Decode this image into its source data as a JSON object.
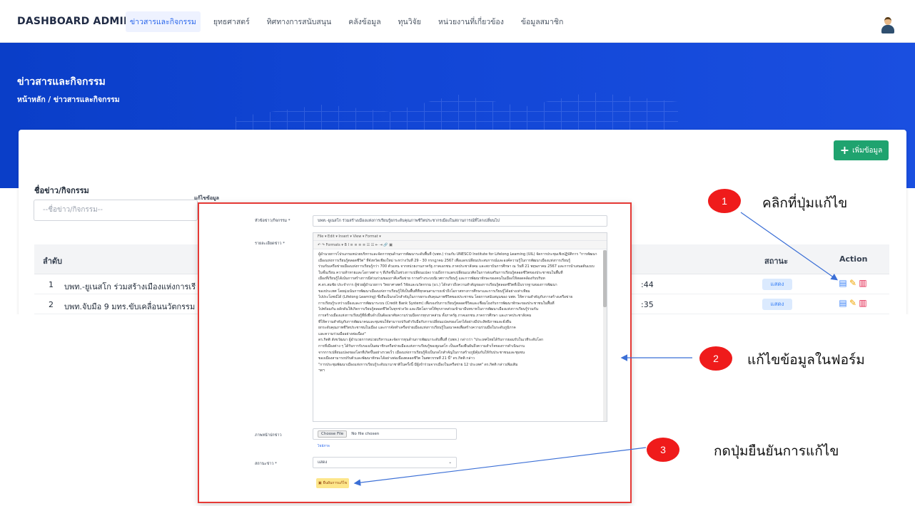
{
  "nav": {
    "brand": "DASHBOARD ADMIN",
    "menu": [
      "ข่าวสารและกิจกรรม",
      "ยุทธศาสตร์",
      "ทิศทางการสนับสนุน",
      "คลังข้อมูล",
      "ทุนวิจัย",
      "หน่วยงานที่เกี่ยวข้อง",
      "ข้อมูลสมาชิก"
    ]
  },
  "hero": {
    "title": "ข่าวสารและกิจกรรม",
    "breadcrumb": "หน้าหลัก / ข่าวสารและกิจกรรม"
  },
  "toolbar": {
    "add_label": "เพิ่มข้อมูล"
  },
  "filter": {
    "label": "ชื่อข่าว/กิจกรรม",
    "placeholder": "--ชื่อข่าว/กิจกรรม--"
  },
  "table": {
    "columns": [
      "ลำดับ",
      "สถานะ",
      "Action"
    ],
    "rows": [
      {
        "no": "1",
        "title": "บพท.-ยูเนสโก ร่วมสร้างเมืองแห่งการเรี",
        "time": ":44",
        "status": "แสดง"
      },
      {
        "no": "2",
        "title": "บพท.จับมือ 9 มทร.ขับเคลื่อนนวัตกรรม",
        "time": ":35",
        "status": "แสดง"
      }
    ]
  },
  "modal": {
    "title": "แก้ไขข้อมูล",
    "headline_label": "หัวข้อข่าว/กิจกรรม *",
    "headline_value": "บพท.-ยูเนสโก ร่วมสร้างเมืองแห่งการเรียนรู้ยกระดับคุณภาพชีวิตประชากรเมืองในสถานการณ์ที่โลกเปลี่ยนไป",
    "detail_label": "รายละเอียดข่าว *",
    "editor_menu": "File ▾   Edit ▾   Insert ▾   View ▾   Format ▾",
    "editor_tools": "↶  ↷   Formats ▾   B   I   ≡  ≡  ≡  ≡   ☷  ☷  ⇤  ⇥   🔗  ▣",
    "editor_lines": [
      "ผู้อำนวยการโปรแกรมหน่วยบริหารและจัดการทุนด้านการพัฒนาระดับพื้นที่ (บพท.) ร่วมกับ UNESCO Institute for Lifelong Learning (UIL) จัดการประชุมเชิงปฏิบัติการ \"การพัฒนา",
      "เมืองแห่งการเรียนรู้ตลอดชีวิต\" ที่จังหวัดเชียงใหม่ ระหว่างวันที่ 29 - 30 กรกฎาคม 2567 เพื่อแลกเปลี่ยนประสบการณ์และองค์ความรู้ในการพัฒนาเมืองแห่งการเรียนรู้",
      "ร่วมกับเครือข่ายเมืองแห่งการเรียนรู้กว่า 700 ตัวแทน จากหน่วยงานภาครัฐ ภาคเอกชน ภาคประชาสังคม และสถาบันการศึกษา ณ วันที่ 21 พฤษภาคม 2567 และการนำเสนอต้นแบบ",
      "ในชั้นเรียน ความท้าทายและโอกาสต่าง ๆ ที่เกิดขึ้นในช่วงการเปลี่ยนแปลง รวมถึงการแลกเปลี่ยนแนวคิดในการส่งเสริมการเรียนรู้ตลอดชีวิตของประชาชนในพื้นที่",
      "เมืองที่เรียนรู้ได้เน้นการสร้างการมีส่วนร่วมของภาคีเครือข่าย การสร้างระบบนิเวศการเรียนรู้ และการพัฒนาทักษะของคนในเมืองให้สอดคล้องกับบริบท",
      "ศ.ดร.สมชัย ประจำการ ผู้ช่วยผู้อำนวยการ วิทยาศาสตร์ วิจัยและนวัตกรรม (อว.) ได้กล่าวถึงความสำคัญของการเรียนรู้ตลอดชีวิตที่เป็นรากฐานของการพัฒนา",
      "ของประเทศ โดยมุ่งเน้นการพัฒนาเมืองแห่งการเรียนรู้ให้เป็นพื้นที่ที่ทุกคนสามารถเข้าถึงโอกาสทางการศึกษาและการเรียนรู้ได้อย่างเท่าเทียม",
      "ไปประโยชน์ได้ (Lifelong Learning) ซึ่งถือเป็นกลไกสำคัญในการยกระดับคุณภาพชีวิตของประชาชน โดยการสนับสนุนของ บพท. ให้ความสำคัญกับการสร้างเครือข่าย",
      "การเรียนรู้ระหว่างเมืองและการพัฒนาระบบ (Credit Bank System) เพื่อรองรับการเรียนรู้ตลอดชีวิตและเชื่อมโยงกับการพัฒนาทักษะของประชาชนในพื้นที่",
      "ไปพร้อมกัน ผลักดันให้เกิดการเรียนรู้ตลอดชีวิตในทุกช่วงวัย และเปิดโอกาสให้ทุกภาคส่วนเข้ามามีบทบาทในการพัฒนาเมืองแห่งการเรียนรู้ร่วมกัน",
      "การสร้างเมืองแห่งการเรียนรู้ที่ยั่งยืนจำเป็นต้องอาศัยความร่วมมือจากทุกภาคส่วน ทั้งภาครัฐ ภาคเอกชน ภาคการศึกษา และภาคประชาสังคม",
      "ที่ให้ความสำคัญกับการพัฒนาคนและชุมชนให้สามารถปรับตัวรับมือกับการเปลี่ยนแปลงของโลกได้อย่างมีประสิทธิภาพและยั่งยืน",
      "ยกระดับคุณภาพชีวิตประชาชนในเมือง และการจัดทำเครือข่ายเมืองแห่งการเรียนรู้ในอนาคตเพื่อสร้างความร่วมมือในระดับภูมิภาค",
      "และความร่วมมืออย่างต่อเนื่อง\"",
      "ดร.กิตติ สังขวัฒนา ผู้อำนวยการหน่วยบริหารและจัดการทุนด้านการพัฒนาระดับพื้นที่ (บพท.) กล่าวว่า \"ประเทศไทยได้รับการยอมรับในเวทีระดับโลก",
      "การที่เมืองต่าง ๆ ได้รับการรับรองเป็นสมาชิกเครือข่ายเมืองแห่งการเรียนรู้ของยูเนสโก เป็นเครื่องยืนยันถึงความสำเร็จของการดำเนินงาน",
      "จากการเปลี่ยนแปลงของโลกที่เกิดขึ้นอย่างรวดเร็ว เมืองแห่งการเรียนรู้จึงเป็นกลไกสำคัญในการสร้างภูมิคุ้มกันให้กับประชาชนและชุมชน",
      "ของเมืองสามารถปรับตัวและพัฒนาทักษะได้อย่างต่อเนื่องตลอดชีวิต ในศตวรรษที่ 21 นี้\" ดร.กิตติ กล่าว",
      "\"การประชุมพัฒนาเมืองแห่งการเรียนรู้ระดับนานาชาติในครั้งนี้ มีผู้เข้าร่วมจากเมืองในเครือข่าย 12 ประเทศ\" ดร.กิตติ กล่าวเพิ่มเติม",
      "ฯลฯ"
    ],
    "image_label": "ภาพหน้าปกข่าว",
    "file_button": "Choose File",
    "file_status": "No file chosen",
    "file_hint": "ไฟล์ภาพ",
    "status_label": "สถานะข่าว *",
    "status_value": "แสดง",
    "submit_label": "ยืนยันการแก้ไข"
  },
  "callouts": [
    {
      "number": "1",
      "text": "คลิกที่ปุ่มแก้ไข"
    },
    {
      "number": "2",
      "text": "แก้ไขข้อมูลในฟอร์ม"
    },
    {
      "number": "3",
      "text": "กดปุ่มยืนยันการแก้ไข"
    }
  ],
  "colors": {
    "primary": "#1246d6",
    "success": "#1fa36f",
    "callout": "#ef1b1b",
    "highlight_border": "#e53935"
  }
}
